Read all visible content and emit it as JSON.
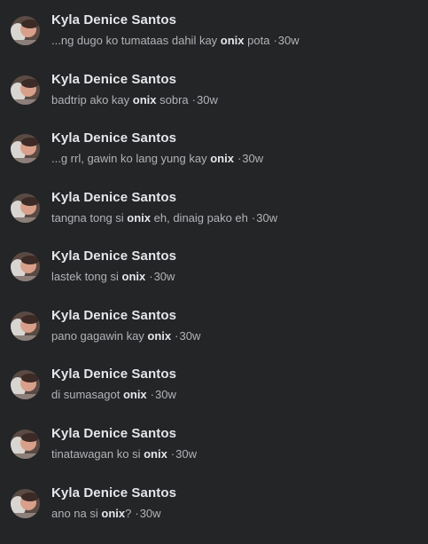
{
  "search_results": [
    {
      "name": "Kyla Denice Santos",
      "before": "...ng dugo ko tumataas dahil kay ",
      "highlight": "onix",
      "after": " pota",
      "separator": "·",
      "time": "30w"
    },
    {
      "name": "Kyla Denice Santos",
      "before": "badtrip ako kay ",
      "highlight": "onix",
      "after": " sobra",
      "separator": "·",
      "time": "30w"
    },
    {
      "name": "Kyla Denice Santos",
      "before": "...g rrl, gawin ko lang yung kay ",
      "highlight": "onix",
      "after": "",
      "separator": "·",
      "time": "30w"
    },
    {
      "name": "Kyla Denice Santos",
      "before": "tangna tong si ",
      "highlight": "onix",
      "after": " eh, dinaig pako eh",
      "separator": "·",
      "time": "30w"
    },
    {
      "name": "Kyla Denice Santos",
      "before": "lastek tong si ",
      "highlight": "onix",
      "after": "",
      "separator": "·",
      "time": "30w"
    },
    {
      "name": "Kyla Denice Santos",
      "before": "pano gagawin kay ",
      "highlight": "onix",
      "after": "",
      "separator": "·",
      "time": "30w"
    },
    {
      "name": "Kyla Denice Santos",
      "before": "di sumasagot ",
      "highlight": "onix",
      "after": "",
      "separator": "·",
      "time": "30w"
    },
    {
      "name": "Kyla Denice Santos",
      "before": "tinatawagan ko si ",
      "highlight": "onix",
      "after": "",
      "separator": "·",
      "time": "30w"
    },
    {
      "name": "Kyla Denice Santos",
      "before": "ano na si ",
      "highlight": "onix",
      "after": "?",
      "separator": "·",
      "time": "30w"
    }
  ],
  "colors": {
    "background": "#242526",
    "name_text": "#e4e6eb",
    "snippet_text": "#b0b3b8",
    "highlight_text": "#e4e6eb"
  }
}
